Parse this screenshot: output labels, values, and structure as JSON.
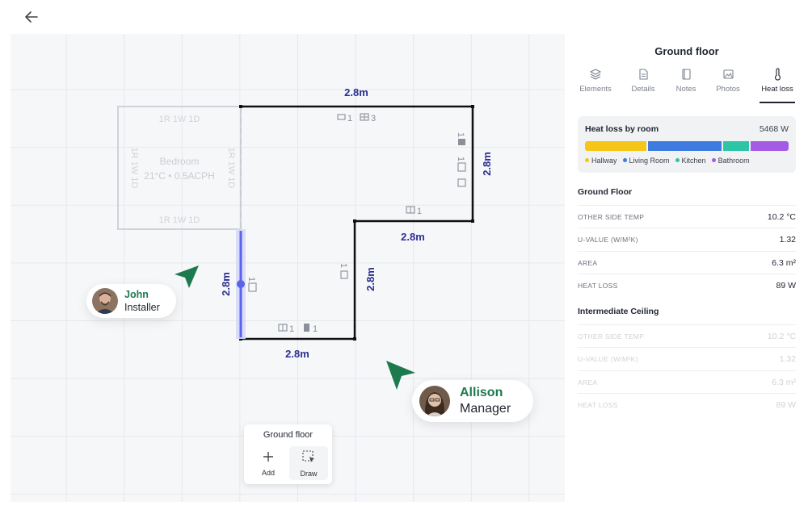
{
  "plan": {
    "dim_top": "2.8m",
    "dim_right": "2.8m",
    "dim_mid": "2.8m",
    "dim_inner_right": "2.8m",
    "dim_bottom": "2.8m",
    "dim_left": "2.8m",
    "ghost_room_name": "Bedroom",
    "ghost_room_info": "21°C • 0.5ACPH",
    "ghost_top": "1R 1W 1D",
    "ghost_bottom": "1R 1W 1D",
    "ghost_left": "1R 1W 1D",
    "ghost_right": "1R 1W 1D",
    "badge_top_a": "1",
    "badge_top_b": "3",
    "badge_right_a": "1",
    "badge_right_b": "1",
    "badge_step": "1",
    "badge_inner": "1",
    "badge_left": "1",
    "badge_bottom_a": "1",
    "badge_bottom_b": "1"
  },
  "users": [
    {
      "name": "John",
      "role": "Installer"
    },
    {
      "name": "Allison",
      "role": "Manager"
    }
  ],
  "toolbar": {
    "title": "Ground floor",
    "tools": [
      {
        "label": "Add",
        "icon": "plus-icon"
      },
      {
        "label": "Draw",
        "icon": "draw-icon"
      }
    ]
  },
  "panel": {
    "title": "Ground floor",
    "tabs": [
      {
        "label": "Elements",
        "icon": "layers-icon"
      },
      {
        "label": "Details",
        "icon": "document-icon"
      },
      {
        "label": "Notes",
        "icon": "notes-icon"
      },
      {
        "label": "Photos",
        "icon": "photos-icon"
      },
      {
        "label": "Heat loss",
        "icon": "thermometer-icon",
        "active": true
      }
    ],
    "heat_loss": {
      "title": "Heat loss by room",
      "total": "5468 W",
      "segments": [
        {
          "name": "Hallway",
          "share": 0.31,
          "color": "#f5c518"
        },
        {
          "name": "Living Room",
          "share": 0.37,
          "color": "#3d7be0"
        },
        {
          "name": "Kitchen",
          "share": 0.13,
          "color": "#2ec4a6"
        },
        {
          "name": "Bathroom",
          "share": 0.19,
          "color": "#a35be6"
        }
      ]
    },
    "sections": [
      {
        "title": "Ground Floor",
        "rows": [
          {
            "key": "Other side temp",
            "value": "10.2 °C"
          },
          {
            "key": "U-value (W/m²K)",
            "value": "1.32"
          },
          {
            "key": "Area",
            "value": "6.3 m²"
          },
          {
            "key": "Heat loss",
            "value": "89 W"
          }
        ]
      },
      {
        "title": "Intermediate Ceiling",
        "rows": [
          {
            "key": "Other side temp",
            "value": "10.2 °C"
          },
          {
            "key": "U-value (W/m²K)",
            "value": "1.32"
          },
          {
            "key": "Area",
            "value": "6.3 m²"
          },
          {
            "key": "Heat loss",
            "value": "89 W"
          }
        ]
      }
    ]
  },
  "colors": {
    "accent_dim": "#2b2f8f",
    "selected_wall": "#5b63e6",
    "cursor_green": "#1d7a4f"
  }
}
